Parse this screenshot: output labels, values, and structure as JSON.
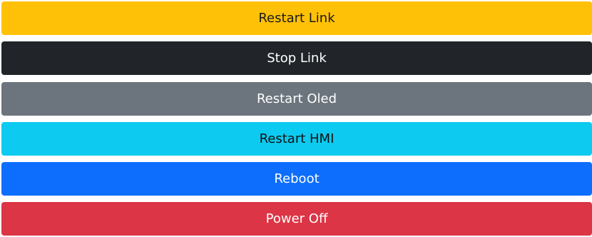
{
  "buttons": {
    "restart_link": "Restart Link",
    "stop_link": "Stop Link",
    "restart_oled": "Restart Oled",
    "restart_hmi": "Restart HMI",
    "reboot": "Reboot",
    "power_off": "Power Off"
  },
  "colors": {
    "warning": "#ffc107",
    "dark": "#212529",
    "secondary": "#6c757d",
    "info": "#0dcaf0",
    "primary": "#0d6efd",
    "danger": "#dc3545"
  }
}
